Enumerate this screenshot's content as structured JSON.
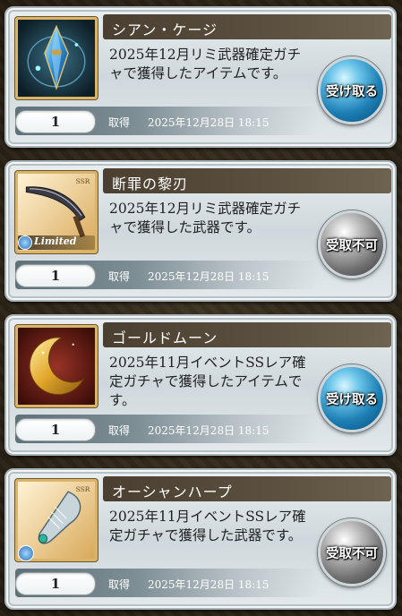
{
  "colors": {
    "claim_button": "#1d7fb4",
    "disabled_button": "#707070",
    "name_bar": "#4a3f30",
    "frame": "#d9b46a"
  },
  "items": [
    {
      "name": "シアン・ケージ",
      "description": "2025年12月リミ武器確定ガチャで獲得したアイテムです。",
      "quantity": "1",
      "acquired_label": "取得",
      "acquired_date": "2025年12月28日 18:15",
      "button_label": "受け取る",
      "button_state": "enabled",
      "icon": "blue-crystal-icon"
    },
    {
      "name": "断罪の黎刃",
      "description": "2025年12月リミ武器確定ガチャで獲得した武器です。",
      "quantity": "1",
      "acquired_label": "取得",
      "acquired_date": "2025年12月28日 18:15",
      "button_label": "受取不可",
      "button_state": "disabled",
      "icon": "scythe-blade-icon",
      "badges": {
        "rarity": "SSR",
        "limited": "Limited"
      }
    },
    {
      "name": "ゴールドムーン",
      "description": "2025年11月イベントSSレア確定ガチャで獲得したアイテムです。",
      "quantity": "1",
      "acquired_label": "取得",
      "acquired_date": "2025年12月28日 18:15",
      "button_label": "受け取る",
      "button_state": "enabled",
      "icon": "gold-moon-icon"
    },
    {
      "name": "オーシャンハープ",
      "description": "2025年11月イベントSSレア確定ガチャで獲得した武器です。",
      "quantity": "1",
      "acquired_label": "取得",
      "acquired_date": "2025年12月28日 18:15",
      "button_label": "受取不可",
      "button_state": "disabled",
      "icon": "harp-icon",
      "badges": {
        "rarity": "SSR"
      }
    }
  ]
}
